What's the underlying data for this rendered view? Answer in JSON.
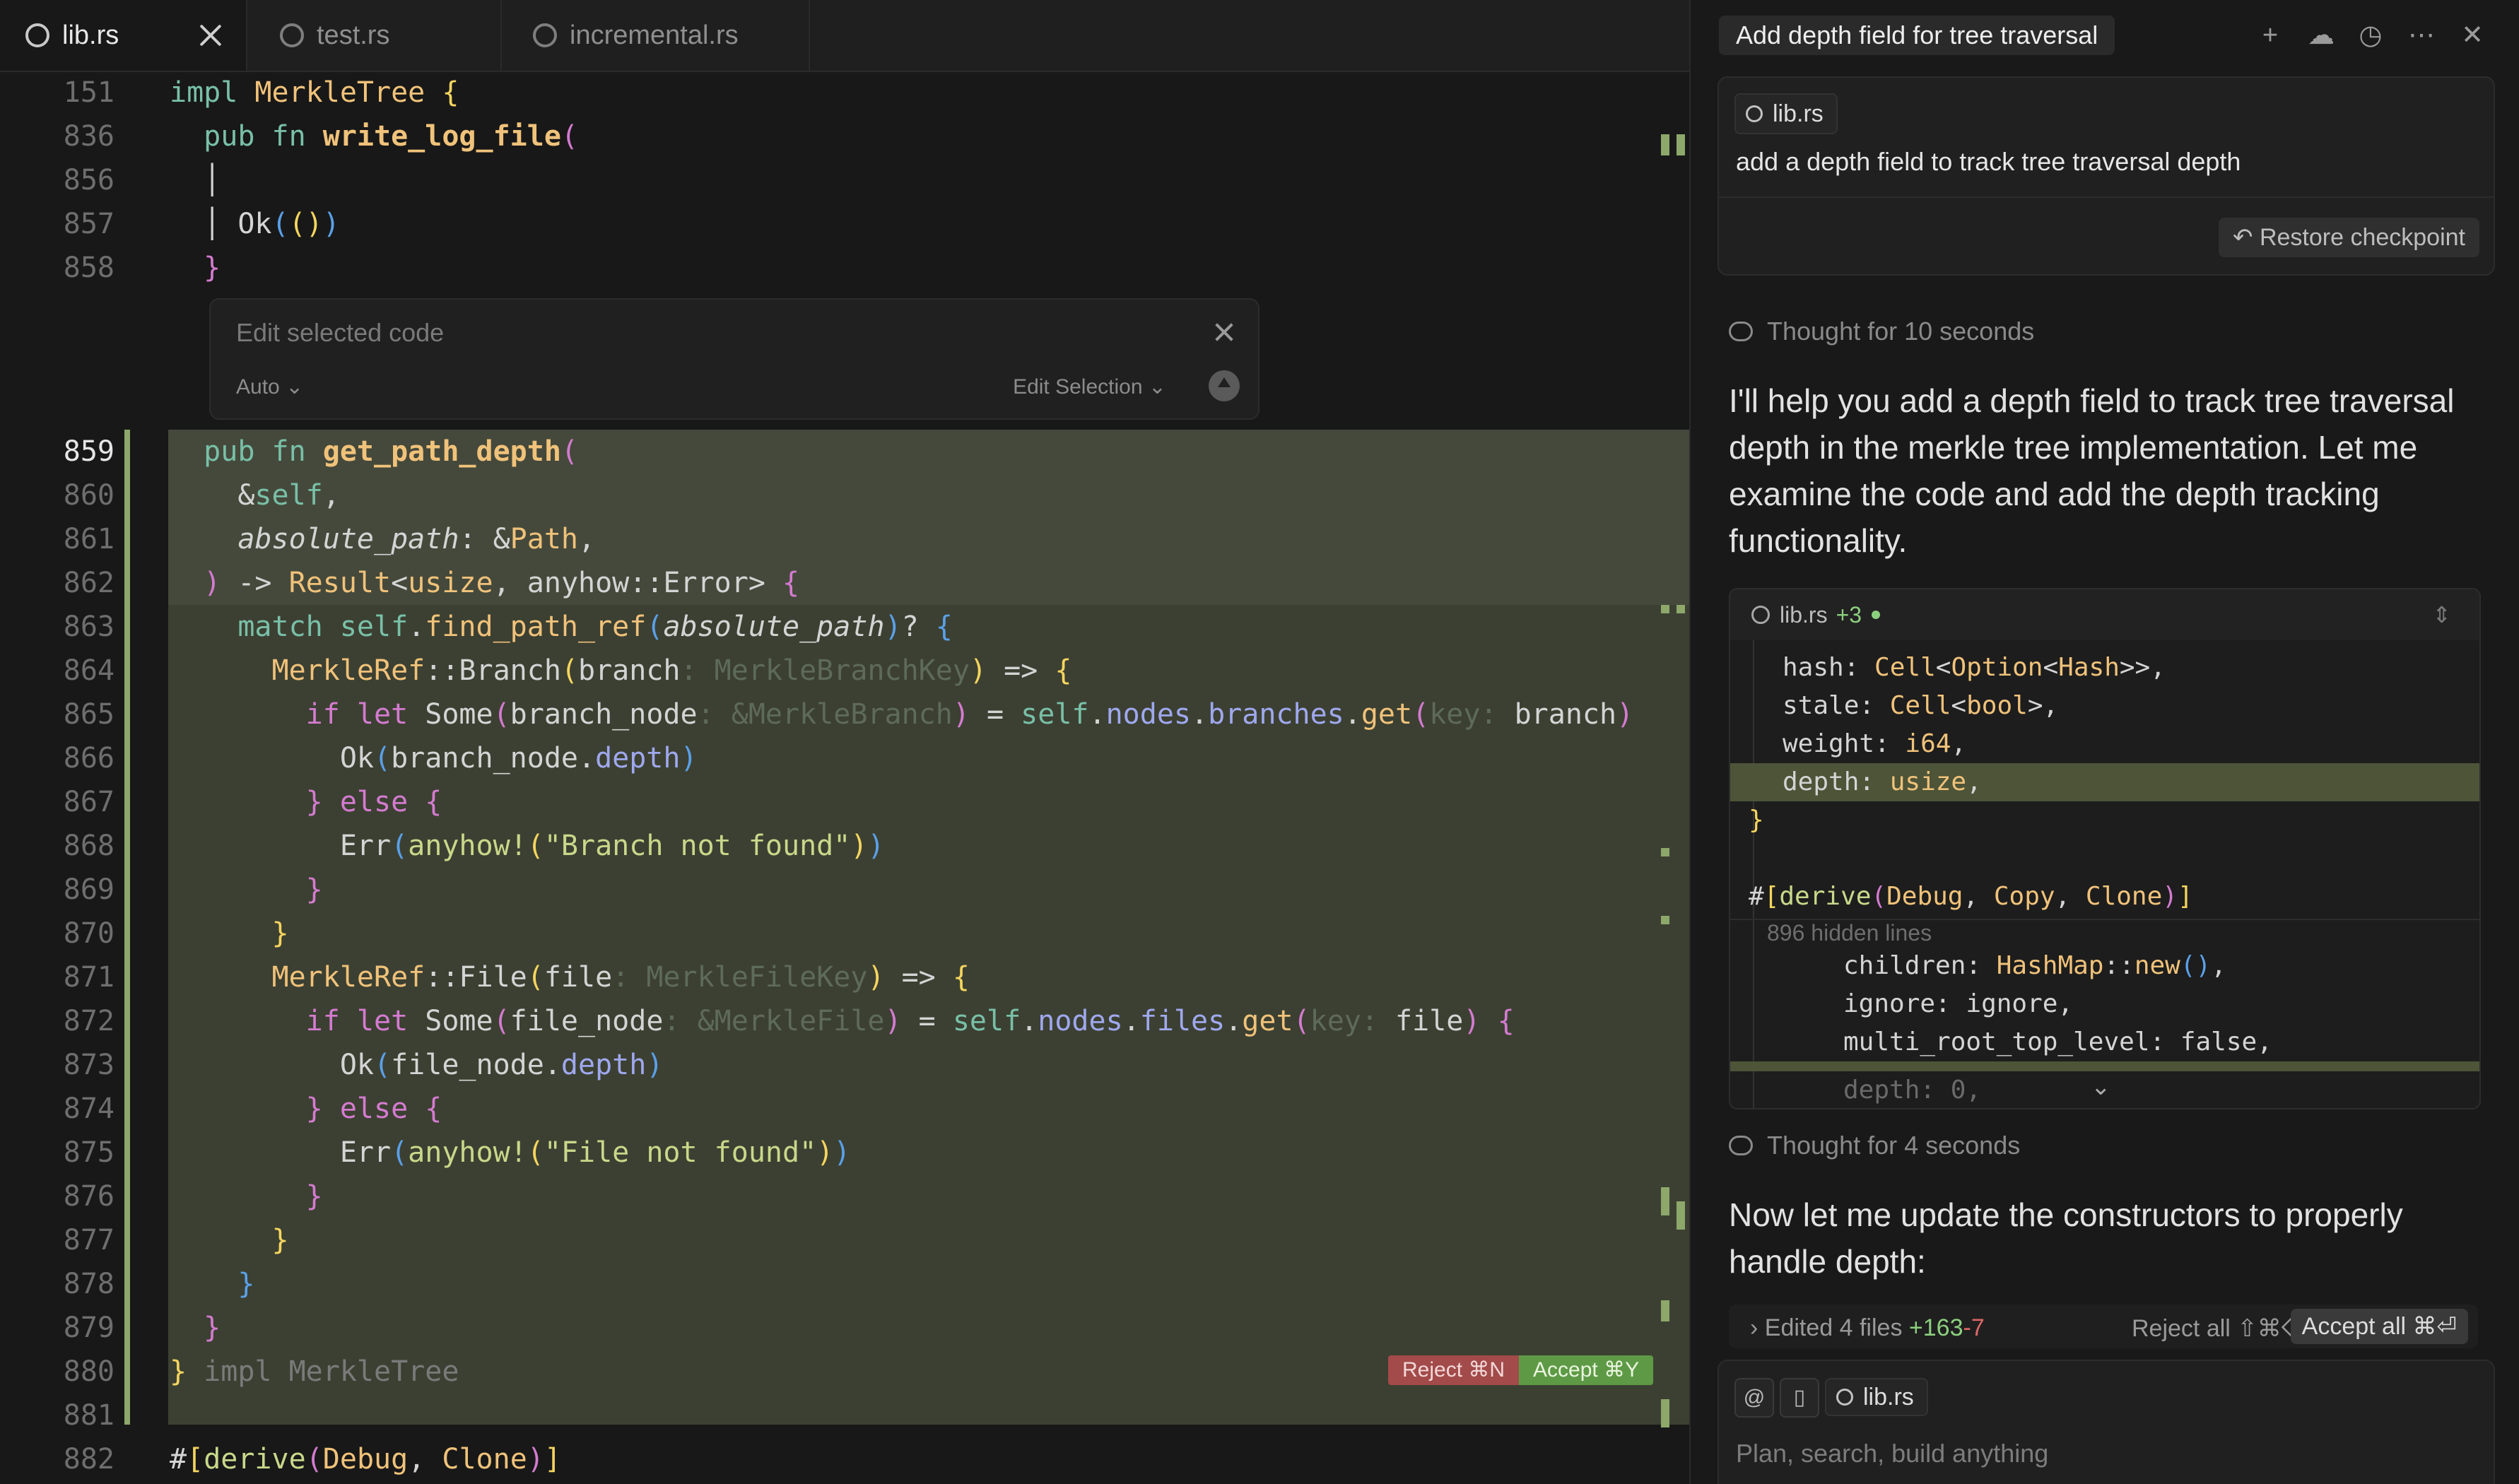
{
  "tabs": [
    {
      "label": "lib.rs",
      "active": true
    },
    {
      "label": "test.rs",
      "active": false
    },
    {
      "label": "incremental.rs",
      "active": false
    }
  ],
  "editor": {
    "line_numbers": [
      "151",
      "836",
      "856",
      "857",
      "858",
      "859",
      "860",
      "861",
      "862",
      "863",
      "864",
      "865",
      "866",
      "867",
      "868",
      "869",
      "870",
      "871",
      "872",
      "873",
      "874",
      "875",
      "876",
      "877",
      "878",
      "879",
      "880",
      "881",
      "882"
    ],
    "edit_box": {
      "placeholder": "Edit selected code",
      "mode": "Auto",
      "action": "Edit Selection"
    },
    "diff_actions": {
      "reject": "Reject ⌘N",
      "accept": "Accept ⌘Y"
    }
  },
  "panel": {
    "title": "Add depth field for tree traversal",
    "user_message": {
      "file_chip": "lib.rs",
      "text": "add a depth field to track tree traversal depth",
      "restore": "Restore checkpoint"
    },
    "thought1": "Thought for 10 seconds",
    "response1": "I'll help you add a depth field to track tree traversal depth in the merkle tree implementation. Let me examine the code and add the depth tracking functionality.",
    "code_card": {
      "file": "lib.rs",
      "changes": "+3",
      "hidden_lines": "896 hidden lines"
    },
    "thought2": "Thought for 4 seconds",
    "response2": "Now let me update the constructors to properly handle depth:",
    "edited": {
      "label": "Edited 4 files",
      "added": "+163",
      "removed": "-7",
      "reject_all": "Reject all ⇧⌘⌫",
      "accept_all": "Accept all ⌘⏎"
    },
    "composer": {
      "file_chip": "lib.rs",
      "placeholder": "Plan, search, build anything",
      "mention": "@"
    }
  },
  "colors": {
    "accent_green": "#8da86a",
    "reject_red": "#a34a4a",
    "accept_green": "#5e9a46"
  }
}
